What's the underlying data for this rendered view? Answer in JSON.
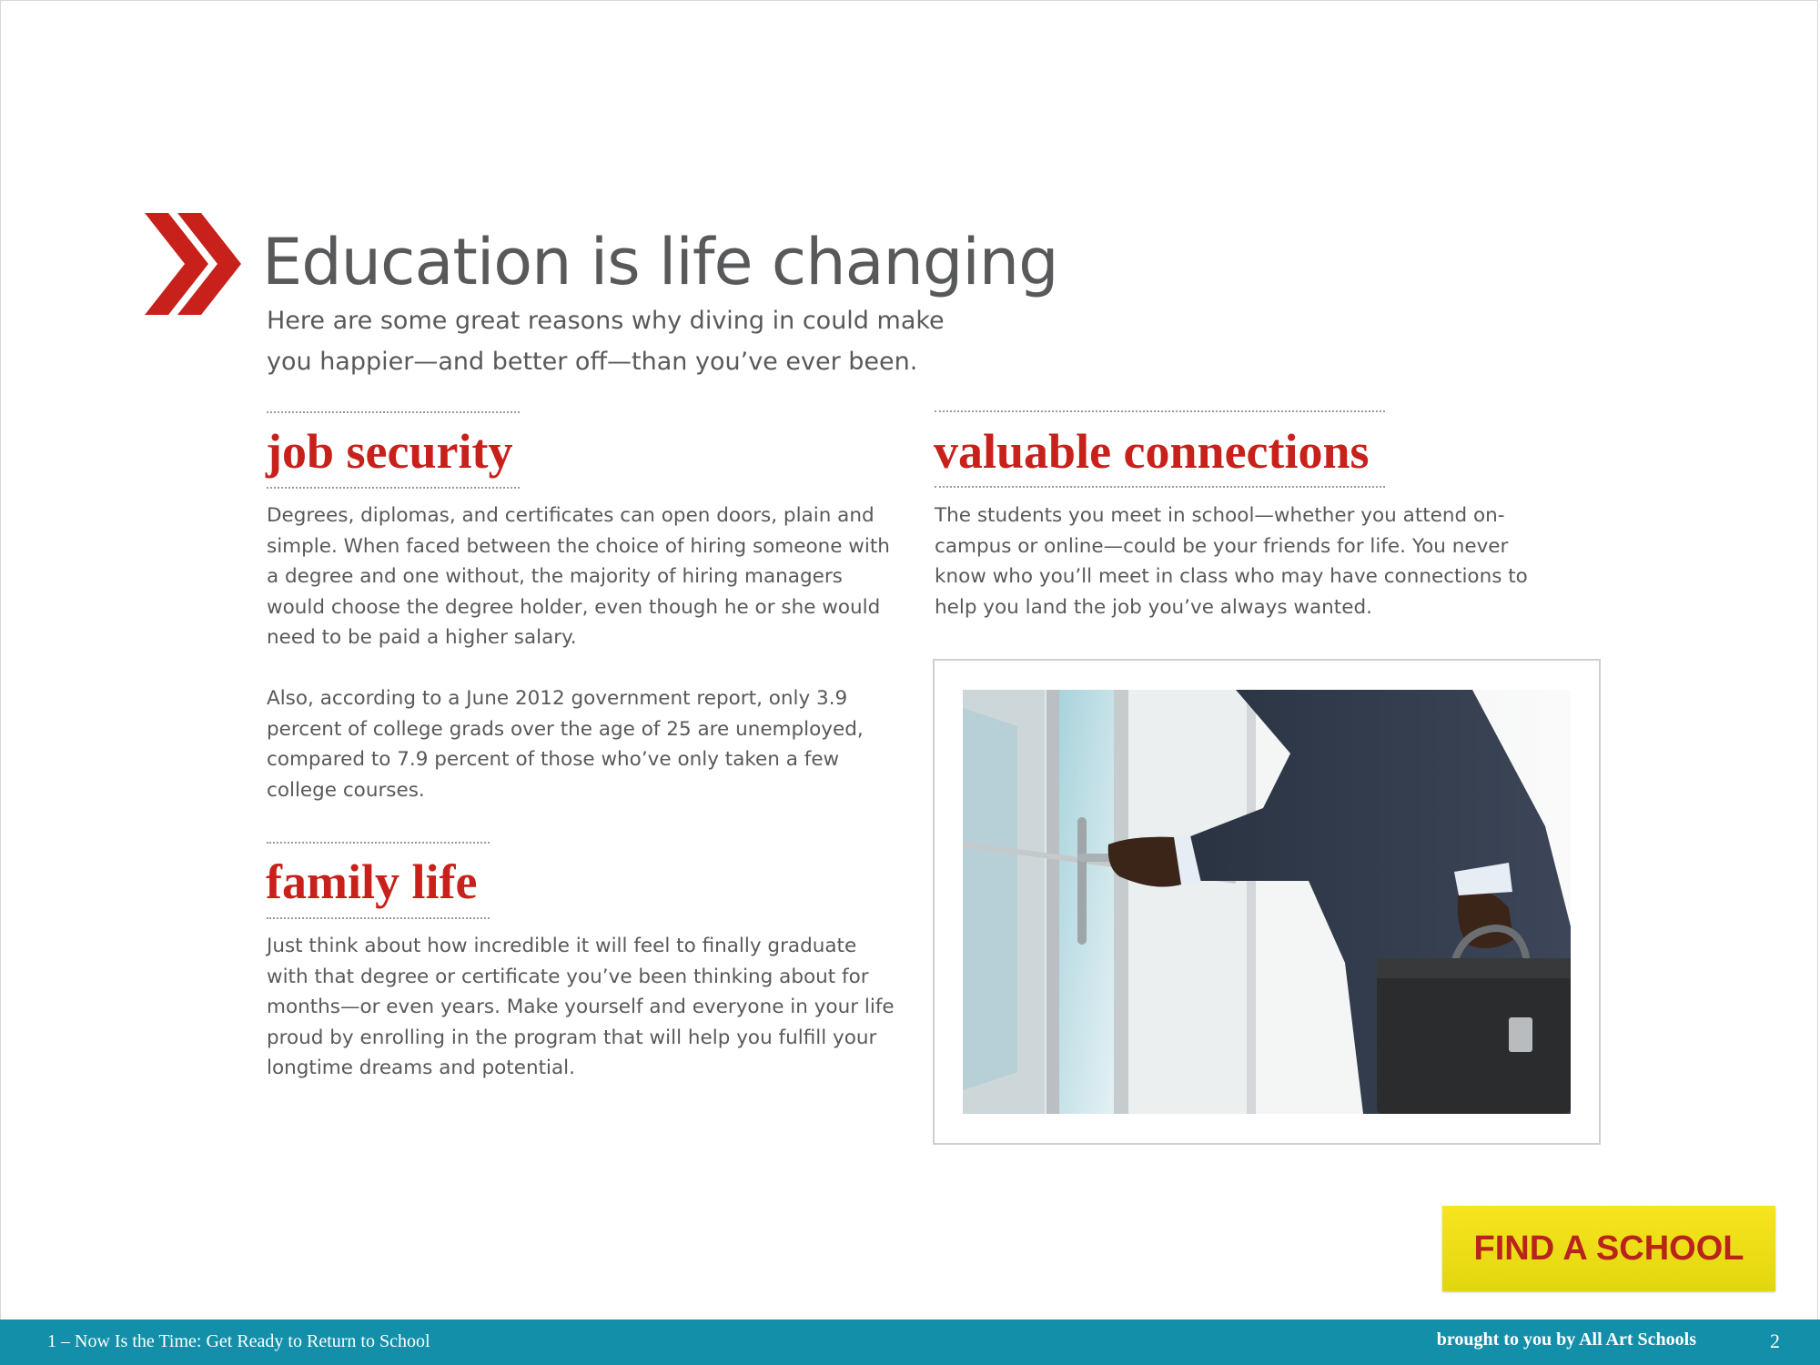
{
  "header": {
    "title": "Education is life changing",
    "subtitle": "Here are some great reasons why diving in could make you happier—and better off—than you’ve ever been."
  },
  "sections": {
    "job_security": {
      "heading": "job security",
      "paragraphs": [
        "Degrees, diplomas, and certificates can open doors, plain and simple. When faced between the choice of hiring someone with a degree and one without, the majority of hiring managers would choose the degree holder, even though he or she would need to be paid a higher salary.",
        "Also, according to a June 2012 government report, only 3.9 percent of college grads over the age of 25 are unemployed, compared to 7.9 percent of those who’ve only taken a few college courses."
      ]
    },
    "family_life": {
      "heading": "family life",
      "paragraphs": [
        "Just think about how incredible it will feel to finally graduate with that degree or certificate you’ve been thinking about for months—or even years. Make yourself and everyone in your life proud by enrolling in the program that will help you fulfill your longtime dreams and potential."
      ]
    },
    "valuable_connections": {
      "heading": "valuable connections",
      "paragraphs": [
        "The students you meet in school—whether you attend on-campus or online—could be your friends for life. You never know who you’ll meet in class who may have connections to help you land the job you’ve always wanted."
      ]
    }
  },
  "cta": {
    "label": "FIND A SCHOOL"
  },
  "footer": {
    "left_text": "1 – Now Is the Time: Get Ready to Return to School",
    "right_text": "brought to you by All Art Schools",
    "page_number": "2"
  },
  "colors": {
    "accent_red": "#c8211b",
    "footer_teal": "#138fa9",
    "button_yellow": "#f7e51e",
    "text_gray": "#58595b"
  },
  "icons": {
    "title_marker": "double-chevron-right-icon"
  }
}
